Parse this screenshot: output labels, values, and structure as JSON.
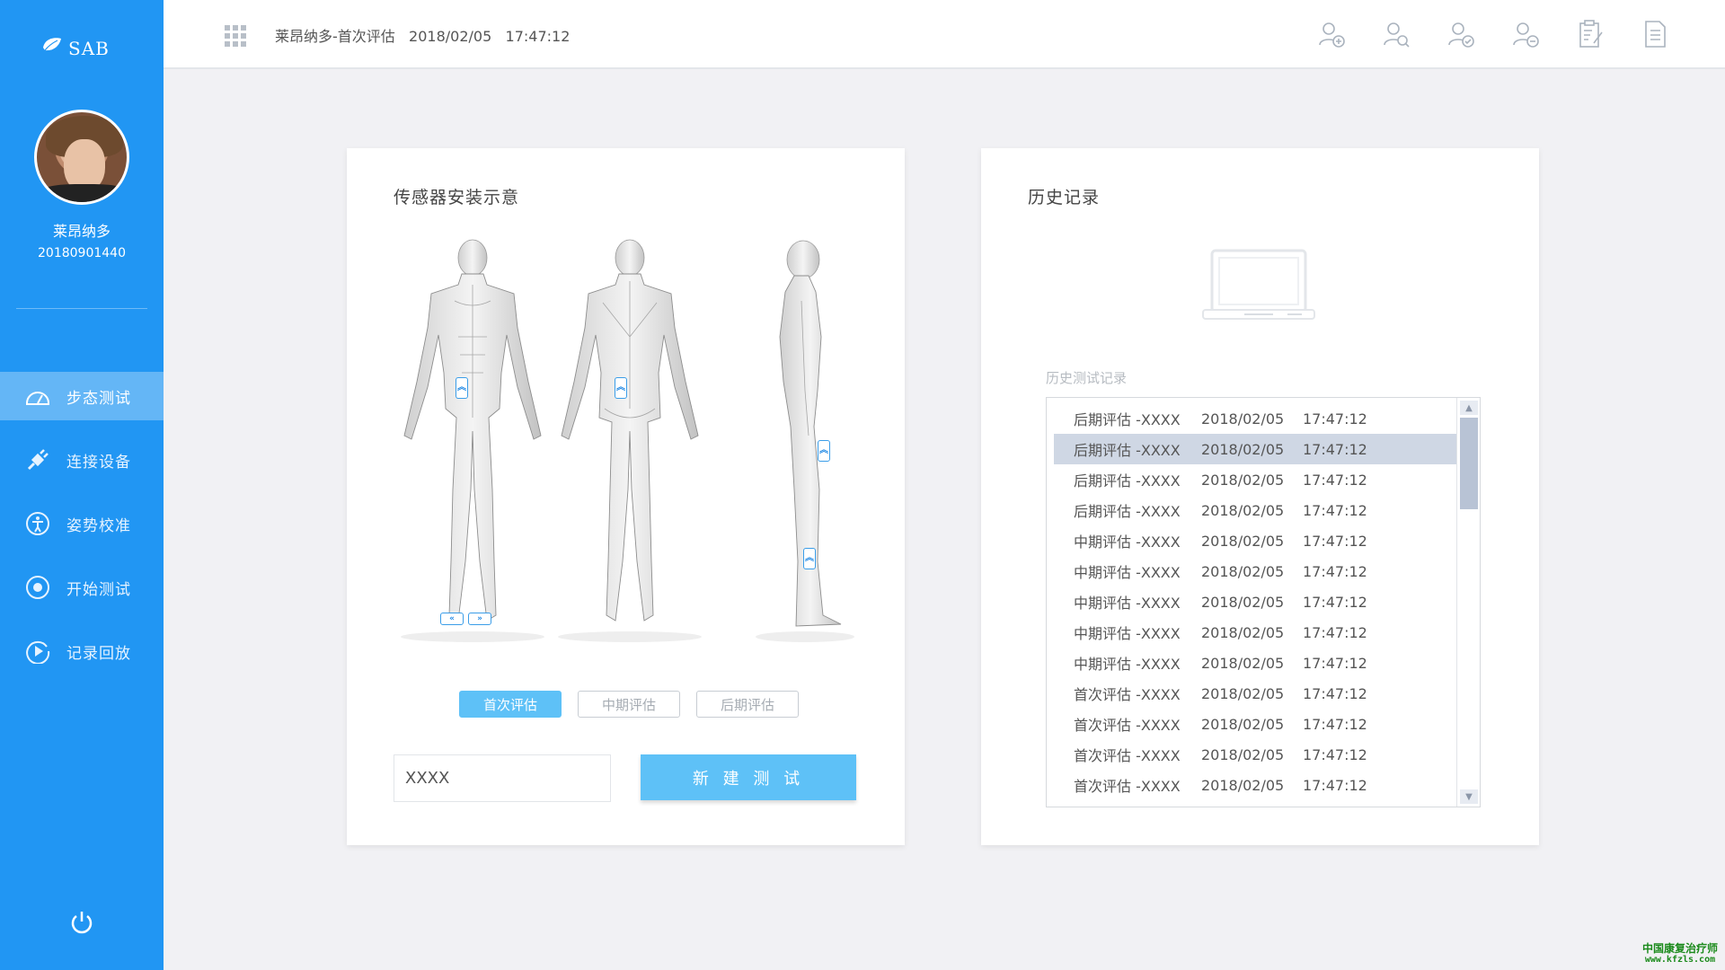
{
  "app": {
    "name": "SAB"
  },
  "user": {
    "name": "莱昂纳多",
    "id": "20180901440"
  },
  "nav": [
    {
      "label": "步态测试",
      "icon": "speedometer-icon",
      "active": true
    },
    {
      "label": "连接设备",
      "icon": "plug-icon",
      "active": false
    },
    {
      "label": "姿势校准",
      "icon": "posture-icon",
      "active": false
    },
    {
      "label": "开始测试",
      "icon": "record-icon",
      "active": false
    },
    {
      "label": "记录回放",
      "icon": "play-icon",
      "active": false
    }
  ],
  "topbar": {
    "patient": "莱昂纳多-首次评估",
    "date": "2018/02/05",
    "time": "17:47:12",
    "icons": [
      "add-user-icon",
      "search-user-icon",
      "check-user-icon",
      "remove-user-icon",
      "clipboard-edit-icon",
      "document-icon"
    ]
  },
  "sensor_card": {
    "title": "传感器安装示意",
    "stages": [
      "首次评估",
      "中期评估",
      "后期评估"
    ],
    "active_stage": 0,
    "name_value": "XXXX",
    "button_label": "新 建 测 试"
  },
  "history_card": {
    "title": "历史记录",
    "list_label": "历史测试记录",
    "selected_index": 1,
    "rows": [
      {
        "name": "后期评估 -XXXX",
        "date": "2018/02/05",
        "time": "17:47:12"
      },
      {
        "name": "后期评估 -XXXX",
        "date": "2018/02/05",
        "time": "17:47:12"
      },
      {
        "name": "后期评估 -XXXX",
        "date": "2018/02/05",
        "time": "17:47:12"
      },
      {
        "name": "后期评估 -XXXX",
        "date": "2018/02/05",
        "time": "17:47:12"
      },
      {
        "name": "中期评估 -XXXX",
        "date": "2018/02/05",
        "time": "17:47:12"
      },
      {
        "name": "中期评估 -XXXX",
        "date": "2018/02/05",
        "time": "17:47:12"
      },
      {
        "name": "中期评估 -XXXX",
        "date": "2018/02/05",
        "time": "17:47:12"
      },
      {
        "name": "中期评估 -XXXX",
        "date": "2018/02/05",
        "time": "17:47:12"
      },
      {
        "name": "中期评估 -XXXX",
        "date": "2018/02/05",
        "time": "17:47:12"
      },
      {
        "name": "首次评估 -XXXX",
        "date": "2018/02/05",
        "time": "17:47:12"
      },
      {
        "name": "首次评估 -XXXX",
        "date": "2018/02/05",
        "time": "17:47:12"
      },
      {
        "name": "首次评估 -XXXX",
        "date": "2018/02/05",
        "time": "17:47:12"
      },
      {
        "name": "首次评估 -XXXX",
        "date": "2018/02/05",
        "time": "17:47:12"
      }
    ]
  },
  "watermark": {
    "line1": "中国康复治疗师",
    "line2": "www.kfzls.com"
  },
  "colors": {
    "sidebar": "#2196f3",
    "accent": "#5ec1f7",
    "selected_row": "#cfd7e4"
  }
}
